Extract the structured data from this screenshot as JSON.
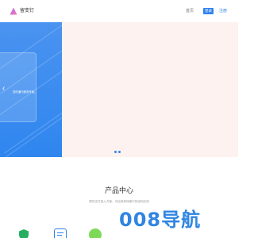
{
  "header": {
    "brand": "留变钉",
    "nav_home": "首页",
    "login_label": "登录",
    "register_label": "注册"
  },
  "hero": {
    "text": "您的通行服务专家。",
    "arrow": "‹",
    "slide_count": 2
  },
  "products": {
    "title": "产品中心",
    "subtitle": "提供支付接入方案、可应用和场景中的结构应用"
  },
  "watermark": {
    "text": "008导航"
  },
  "colors": {
    "accent": "#2f80ed",
    "hero_bg": "#fdf2ef",
    "hero_blue": "#3b8cf0",
    "watermark": "#1f7be0",
    "green": "#7ed957",
    "shield": "#27ae60"
  },
  "icons": [
    "logo-icon",
    "shield-icon",
    "document-icon",
    "circle-icon"
  ]
}
